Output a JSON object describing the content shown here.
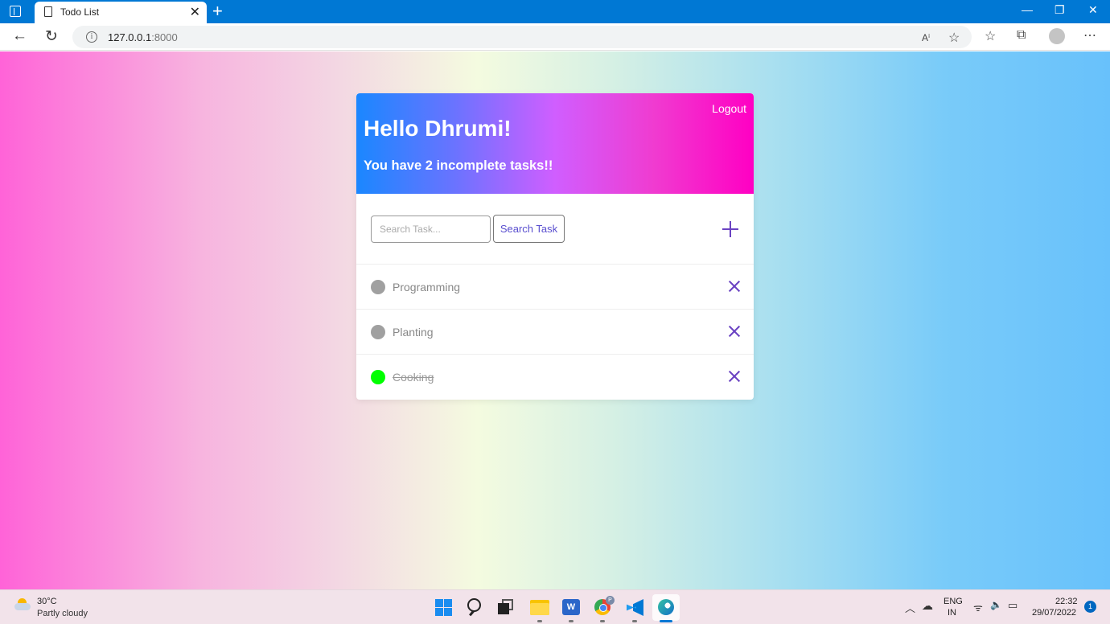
{
  "browser": {
    "tab_title": "Todo List",
    "url_host": "127.0.0.1",
    "url_port": ":8000",
    "icons": {
      "back": "←",
      "refresh": "↻",
      "read_aloud": "Aⁱ",
      "favorites_add": "☆",
      "favorites": "☆",
      "collections": "⧉",
      "more": "⋯",
      "minimize": "—",
      "restore": "❐",
      "close": "✕",
      "new_tab": "+",
      "tab_close": "✕"
    }
  },
  "app": {
    "logout_label": "Logout",
    "greeting": "Hello Dhrumi!",
    "subtitle": "You have 2 incomplete tasks!!",
    "search": {
      "placeholder": "Search Task...",
      "button_label": "Search Task"
    },
    "tasks": [
      {
        "label": "Programming",
        "completed": false,
        "dot_color": "#a0a0a0"
      },
      {
        "label": "Planting",
        "completed": false,
        "dot_color": "#a0a0a0"
      },
      {
        "label": "Cooking",
        "completed": true,
        "dot_color": "#00ff00"
      }
    ],
    "accent_color": "#6a42c2"
  },
  "taskbar": {
    "weather_temp": "30°C",
    "weather_desc": "Partly cloudy",
    "word_letter": "W",
    "chrome_profile": "P",
    "lang_top": "ENG",
    "lang_bottom": "IN",
    "time": "22:32",
    "date": "29/07/2022",
    "notifications": "1",
    "tray_icons": {
      "chevron": "︿",
      "cloud": "☁",
      "wifi": "ᯤ",
      "volume": "🔈",
      "battery": "▭"
    }
  }
}
